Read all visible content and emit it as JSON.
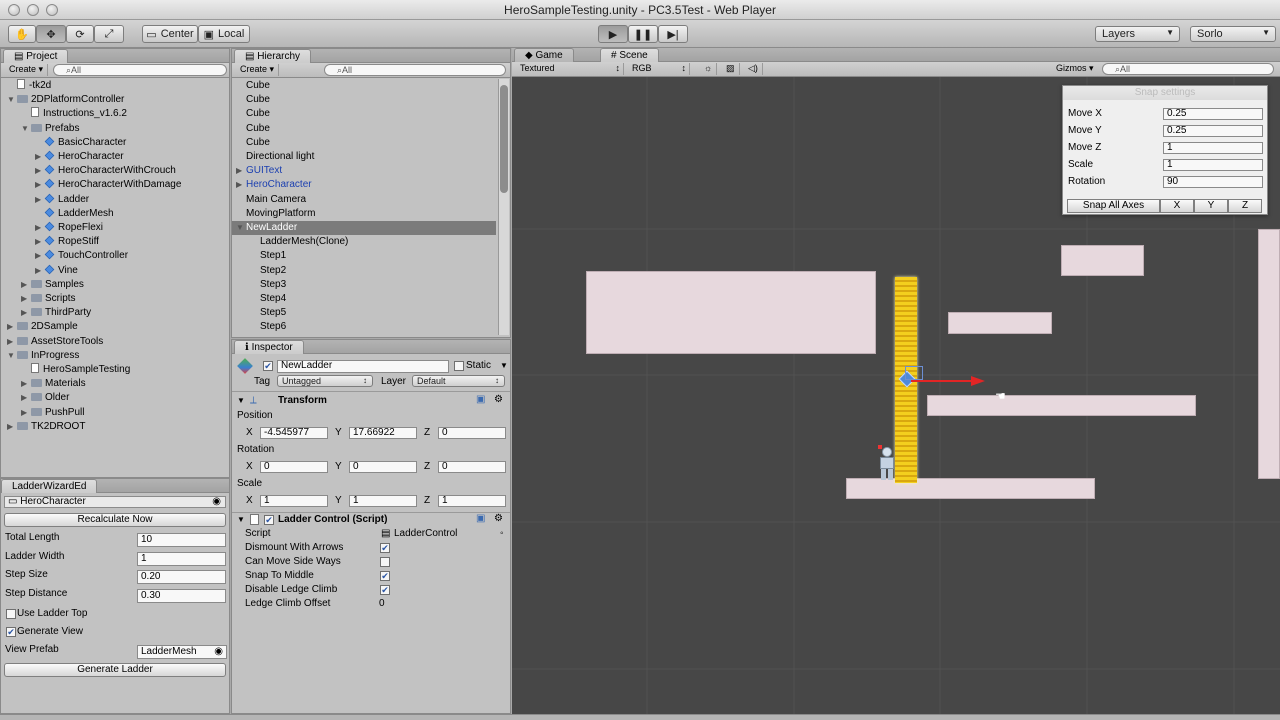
{
  "window": {
    "title": "HeroSampleTesting.unity - PC3.5Test - Web Player"
  },
  "toolbar": {
    "center_label": "Center",
    "local_label": "Local",
    "layers_label": "Layers",
    "layout_label": "Sorlo"
  },
  "project": {
    "tab": "Project",
    "create": "Create",
    "search": "⌕All",
    "items": [
      {
        "label": "-tk2d",
        "depth": 0,
        "icon": "doc",
        "arrow": ""
      },
      {
        "label": "2DPlatformController",
        "depth": 0,
        "icon": "folder",
        "arrow": "▼"
      },
      {
        "label": "Instructions_v1.6.2",
        "depth": 1,
        "icon": "doc",
        "arrow": ""
      },
      {
        "label": "Prefabs",
        "depth": 1,
        "icon": "folder",
        "arrow": "▼"
      },
      {
        "label": "BasicCharacter",
        "depth": 2,
        "icon": "prefab",
        "arrow": ""
      },
      {
        "label": "HeroCharacter",
        "depth": 2,
        "icon": "prefab",
        "arrow": "▶"
      },
      {
        "label": "HeroCharacterWithCrouch",
        "depth": 2,
        "icon": "prefab",
        "arrow": "▶"
      },
      {
        "label": "HeroCharacterWithDamage",
        "depth": 2,
        "icon": "prefab",
        "arrow": "▶"
      },
      {
        "label": "Ladder",
        "depth": 2,
        "icon": "prefab",
        "arrow": "▶"
      },
      {
        "label": "LadderMesh",
        "depth": 2,
        "icon": "prefab",
        "arrow": ""
      },
      {
        "label": "RopeFlexi",
        "depth": 2,
        "icon": "prefab",
        "arrow": "▶"
      },
      {
        "label": "RopeStiff",
        "depth": 2,
        "icon": "prefab",
        "arrow": "▶"
      },
      {
        "label": "TouchController",
        "depth": 2,
        "icon": "prefab",
        "arrow": "▶"
      },
      {
        "label": "Vine",
        "depth": 2,
        "icon": "prefab",
        "arrow": "▶"
      },
      {
        "label": "Samples",
        "depth": 1,
        "icon": "folder",
        "arrow": "▶"
      },
      {
        "label": "Scripts",
        "depth": 1,
        "icon": "folder",
        "arrow": "▶"
      },
      {
        "label": "ThirdParty",
        "depth": 1,
        "icon": "folder",
        "arrow": "▶"
      },
      {
        "label": "2DSample",
        "depth": 0,
        "icon": "folder",
        "arrow": "▶"
      },
      {
        "label": "AssetStoreTools",
        "depth": 0,
        "icon": "folder",
        "arrow": "▶"
      },
      {
        "label": "InProgress",
        "depth": 0,
        "icon": "folder",
        "arrow": "▼"
      },
      {
        "label": "HeroSampleTesting",
        "depth": 1,
        "icon": "doc",
        "arrow": ""
      },
      {
        "label": "Materials",
        "depth": 1,
        "icon": "folder",
        "arrow": "▶"
      },
      {
        "label": "Older",
        "depth": 1,
        "icon": "folder",
        "arrow": "▶"
      },
      {
        "label": "PushPull",
        "depth": 1,
        "icon": "folder",
        "arrow": "▶"
      },
      {
        "label": "TK2DROOT",
        "depth": 0,
        "icon": "folder",
        "arrow": "▶"
      }
    ]
  },
  "wizard": {
    "tab": "LadderWizardEd",
    "character": "HeroCharacter",
    "recalculate": "Recalculate Now",
    "fields": [
      {
        "label": "Total Length",
        "value": "10"
      },
      {
        "label": "Ladder Width",
        "value": "1"
      },
      {
        "label": "Step Size",
        "value": "0.20"
      },
      {
        "label": "Step Distance",
        "value": "0.30"
      }
    ],
    "use_ladder_top": "Use Ladder Top",
    "generate_view": "Generate View",
    "view_prefab_label": "View Prefab",
    "view_prefab_value": "LadderMesh",
    "generate": "Generate Ladder"
  },
  "hierarchy": {
    "tab": "Hierarchy",
    "create": "Create",
    "search": "⌕All",
    "items": [
      {
        "label": "Cube",
        "depth": 0,
        "arrow": ""
      },
      {
        "label": "Cube",
        "depth": 0,
        "arrow": ""
      },
      {
        "label": "Cube",
        "depth": 0,
        "arrow": ""
      },
      {
        "label": "Cube",
        "depth": 0,
        "arrow": ""
      },
      {
        "label": "Cube",
        "depth": 0,
        "arrow": ""
      },
      {
        "label": "Directional light",
        "depth": 0,
        "arrow": ""
      },
      {
        "label": "GUIText",
        "depth": 0,
        "arrow": "▶",
        "blue": true
      },
      {
        "label": "HeroCharacter",
        "depth": 0,
        "arrow": "▶",
        "blue": true
      },
      {
        "label": "Main Camera",
        "depth": 0,
        "arrow": ""
      },
      {
        "label": "MovingPlatform",
        "depth": 0,
        "arrow": ""
      },
      {
        "label": "NewLadder",
        "depth": 0,
        "arrow": "▼",
        "selected": true
      },
      {
        "label": "LadderMesh(Clone)",
        "depth": 1,
        "arrow": ""
      },
      {
        "label": "Step1",
        "depth": 1,
        "arrow": ""
      },
      {
        "label": "Step2",
        "depth": 1,
        "arrow": ""
      },
      {
        "label": "Step3",
        "depth": 1,
        "arrow": ""
      },
      {
        "label": "Step4",
        "depth": 1,
        "arrow": ""
      },
      {
        "label": "Step5",
        "depth": 1,
        "arrow": ""
      },
      {
        "label": "Step6",
        "depth": 1,
        "arrow": ""
      }
    ]
  },
  "inspector": {
    "tab": "Inspector",
    "name": "NewLadder",
    "static": "Static",
    "tag_label": "Tag",
    "tag_value": "Untagged",
    "layer_label": "Layer",
    "layer_value": "Default",
    "transform": "Transform",
    "position": "Position",
    "rotation": "Rotation",
    "scale": "Scale",
    "pos": {
      "x": "-4.545977",
      "y": "17.66922",
      "z": "0"
    },
    "rot": {
      "x": "0",
      "y": "0",
      "z": "0"
    },
    "scl": {
      "x": "1",
      "y": "1",
      "z": "1"
    },
    "axis_x": "X",
    "axis_y": "Y",
    "axis_z": "Z",
    "script_title": "Ladder Control (Script)",
    "script_label": "Script",
    "script_value": "LadderControl",
    "props": [
      {
        "label": "Dismount With Arrows",
        "checked": true
      },
      {
        "label": "Can Move Side Ways",
        "checked": false
      },
      {
        "label": "Snap To Middle",
        "checked": true
      },
      {
        "label": "Disable Ledge Climb",
        "checked": true
      }
    ],
    "ledge_label": "Ledge Climb Offset",
    "ledge_value": "0"
  },
  "view": {
    "tab_game": "Game",
    "tab_scene": "Scene",
    "shading": "Textured",
    "mode": "RGB",
    "gizmos": "Gizmos",
    "search": "⌕All"
  },
  "snap": {
    "title": "Snap settings",
    "rows": [
      {
        "label": "Move X",
        "value": "0.25"
      },
      {
        "label": "Move Y",
        "value": "0.25"
      },
      {
        "label": "Move Z",
        "value": "1"
      },
      {
        "label": "Scale",
        "value": "1"
      },
      {
        "label": "Rotation",
        "value": "90"
      }
    ],
    "all": "Snap All Axes",
    "x": "X",
    "y": "Y",
    "z": "Z"
  },
  "colors": {
    "ladder": "#f4cf1e",
    "platform": "#e7d8dd",
    "selection": "#3b73b8",
    "scene_bg": "#474747"
  }
}
